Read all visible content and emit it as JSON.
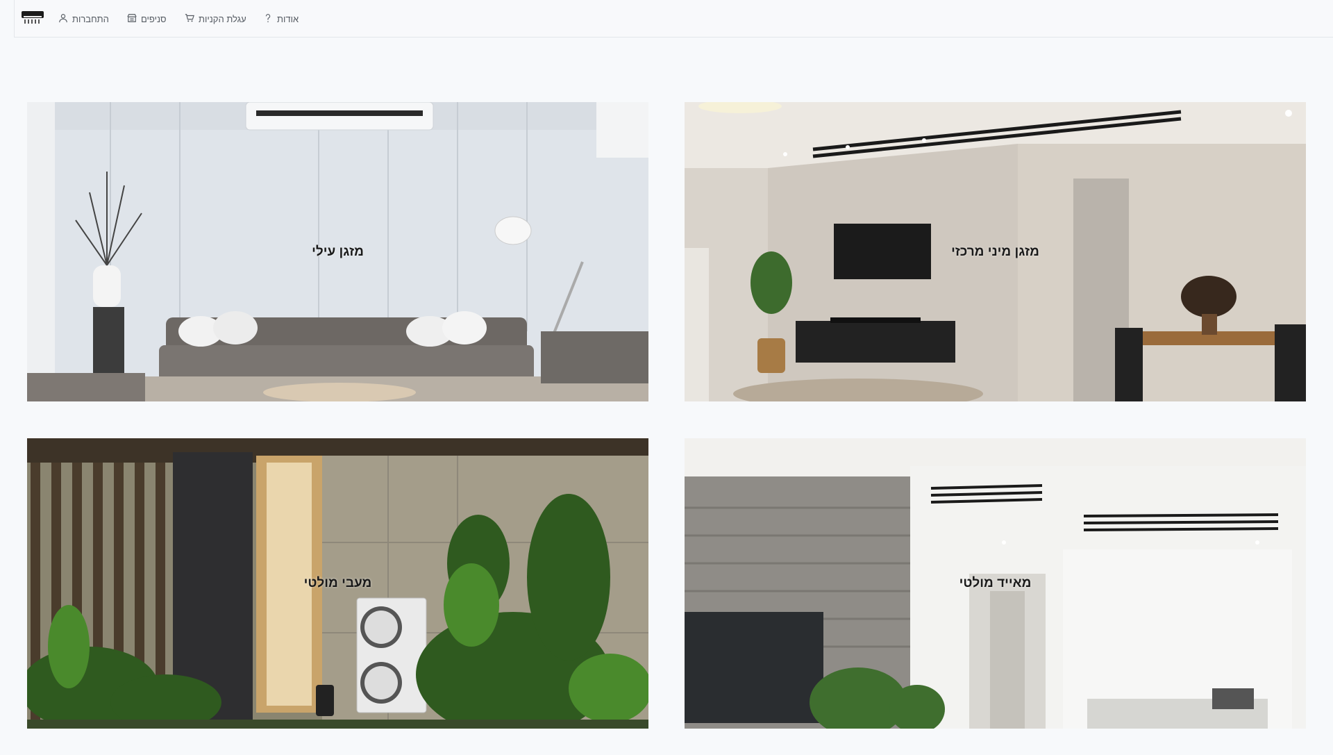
{
  "nav": {
    "login": "התחברות",
    "branches": "סניפים",
    "cart": "עגלת הקניות",
    "about": "אודות"
  },
  "categories": [
    {
      "label": "מזגן עילי"
    },
    {
      "label": "מזגן מיני מרכזי"
    },
    {
      "label": "מעבי מולטי"
    },
    {
      "label": "מאייד מולטי"
    }
  ]
}
